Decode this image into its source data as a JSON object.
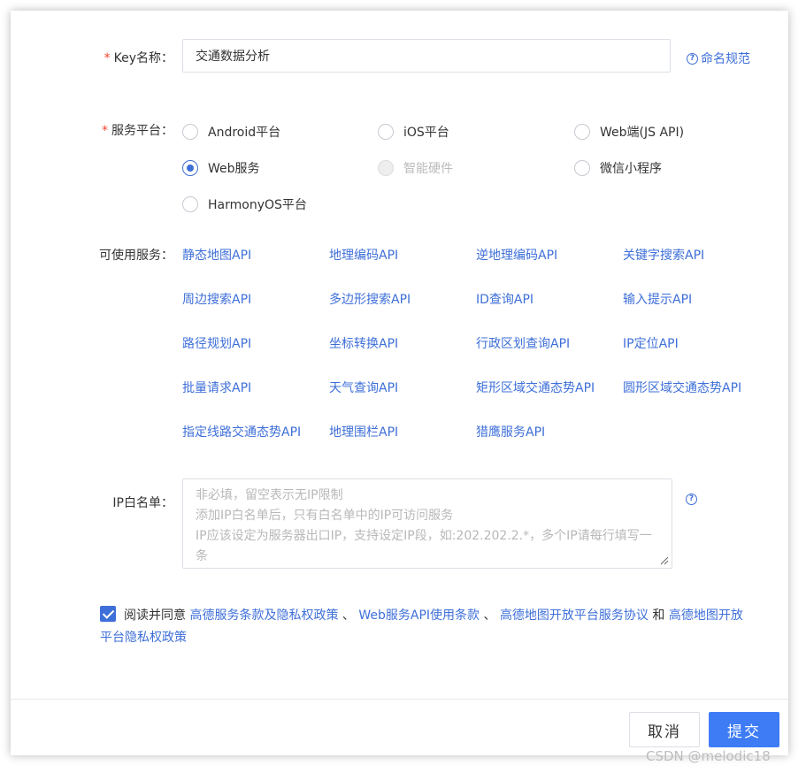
{
  "form": {
    "key_name": {
      "label": "Key名称：",
      "value": "交通数据分析",
      "help_link": "命名规范"
    },
    "platform": {
      "label": "服务平台：",
      "options": [
        {
          "label": "Android平台",
          "checked": false,
          "disabled": false
        },
        {
          "label": "iOS平台",
          "checked": false,
          "disabled": false
        },
        {
          "label": "Web端(JS API)",
          "checked": false,
          "disabled": false
        },
        {
          "label": "Web服务",
          "checked": true,
          "disabled": false
        },
        {
          "label": "智能硬件",
          "checked": false,
          "disabled": true
        },
        {
          "label": "微信小程序",
          "checked": false,
          "disabled": false
        },
        {
          "label": "HarmonyOS平台",
          "checked": false,
          "disabled": false
        }
      ]
    },
    "services": {
      "label": "可使用服务：",
      "items": [
        "静态地图API",
        "地理编码API",
        "逆地理编码API",
        "关键字搜索API",
        "周边搜索API",
        "多边形搜索API",
        "ID查询API",
        "输入提示API",
        "路径规划API",
        "坐标转换API",
        "行政区划查询API",
        "IP定位API",
        "批量请求API",
        "天气查询API",
        "矩形区域交通态势API",
        "圆形区域交通态势API",
        "指定线路交通态势API",
        "地理围栏API",
        "猎鹰服务API"
      ]
    },
    "ip_whitelist": {
      "label": "IP白名单：",
      "value": "",
      "placeholder": "非必填，留空表示无IP限制\n添加IP白名单后，只有白名单中的IP可访问服务\nIP应该设定为服务器出口IP，支持设定IP段，如:202.202.2.*，多个IP请每行填写一条"
    },
    "agreement": {
      "checked": true,
      "prefix": "阅读并同意",
      "links": [
        "高德服务条款及隐私权政策",
        "Web服务API使用条款",
        "高德地图开放平台服务协议",
        "高德地图开放平台隐私权政策"
      ],
      "sep1": "、",
      "sep2": "、",
      "and": "和"
    }
  },
  "buttons": {
    "cancel": "取消",
    "submit": "提交"
  },
  "watermark": "CSDN @melodic18",
  "colors": {
    "accent": "#3e6fd8",
    "required": "#f5452f",
    "submit": "#3e7cf5"
  }
}
